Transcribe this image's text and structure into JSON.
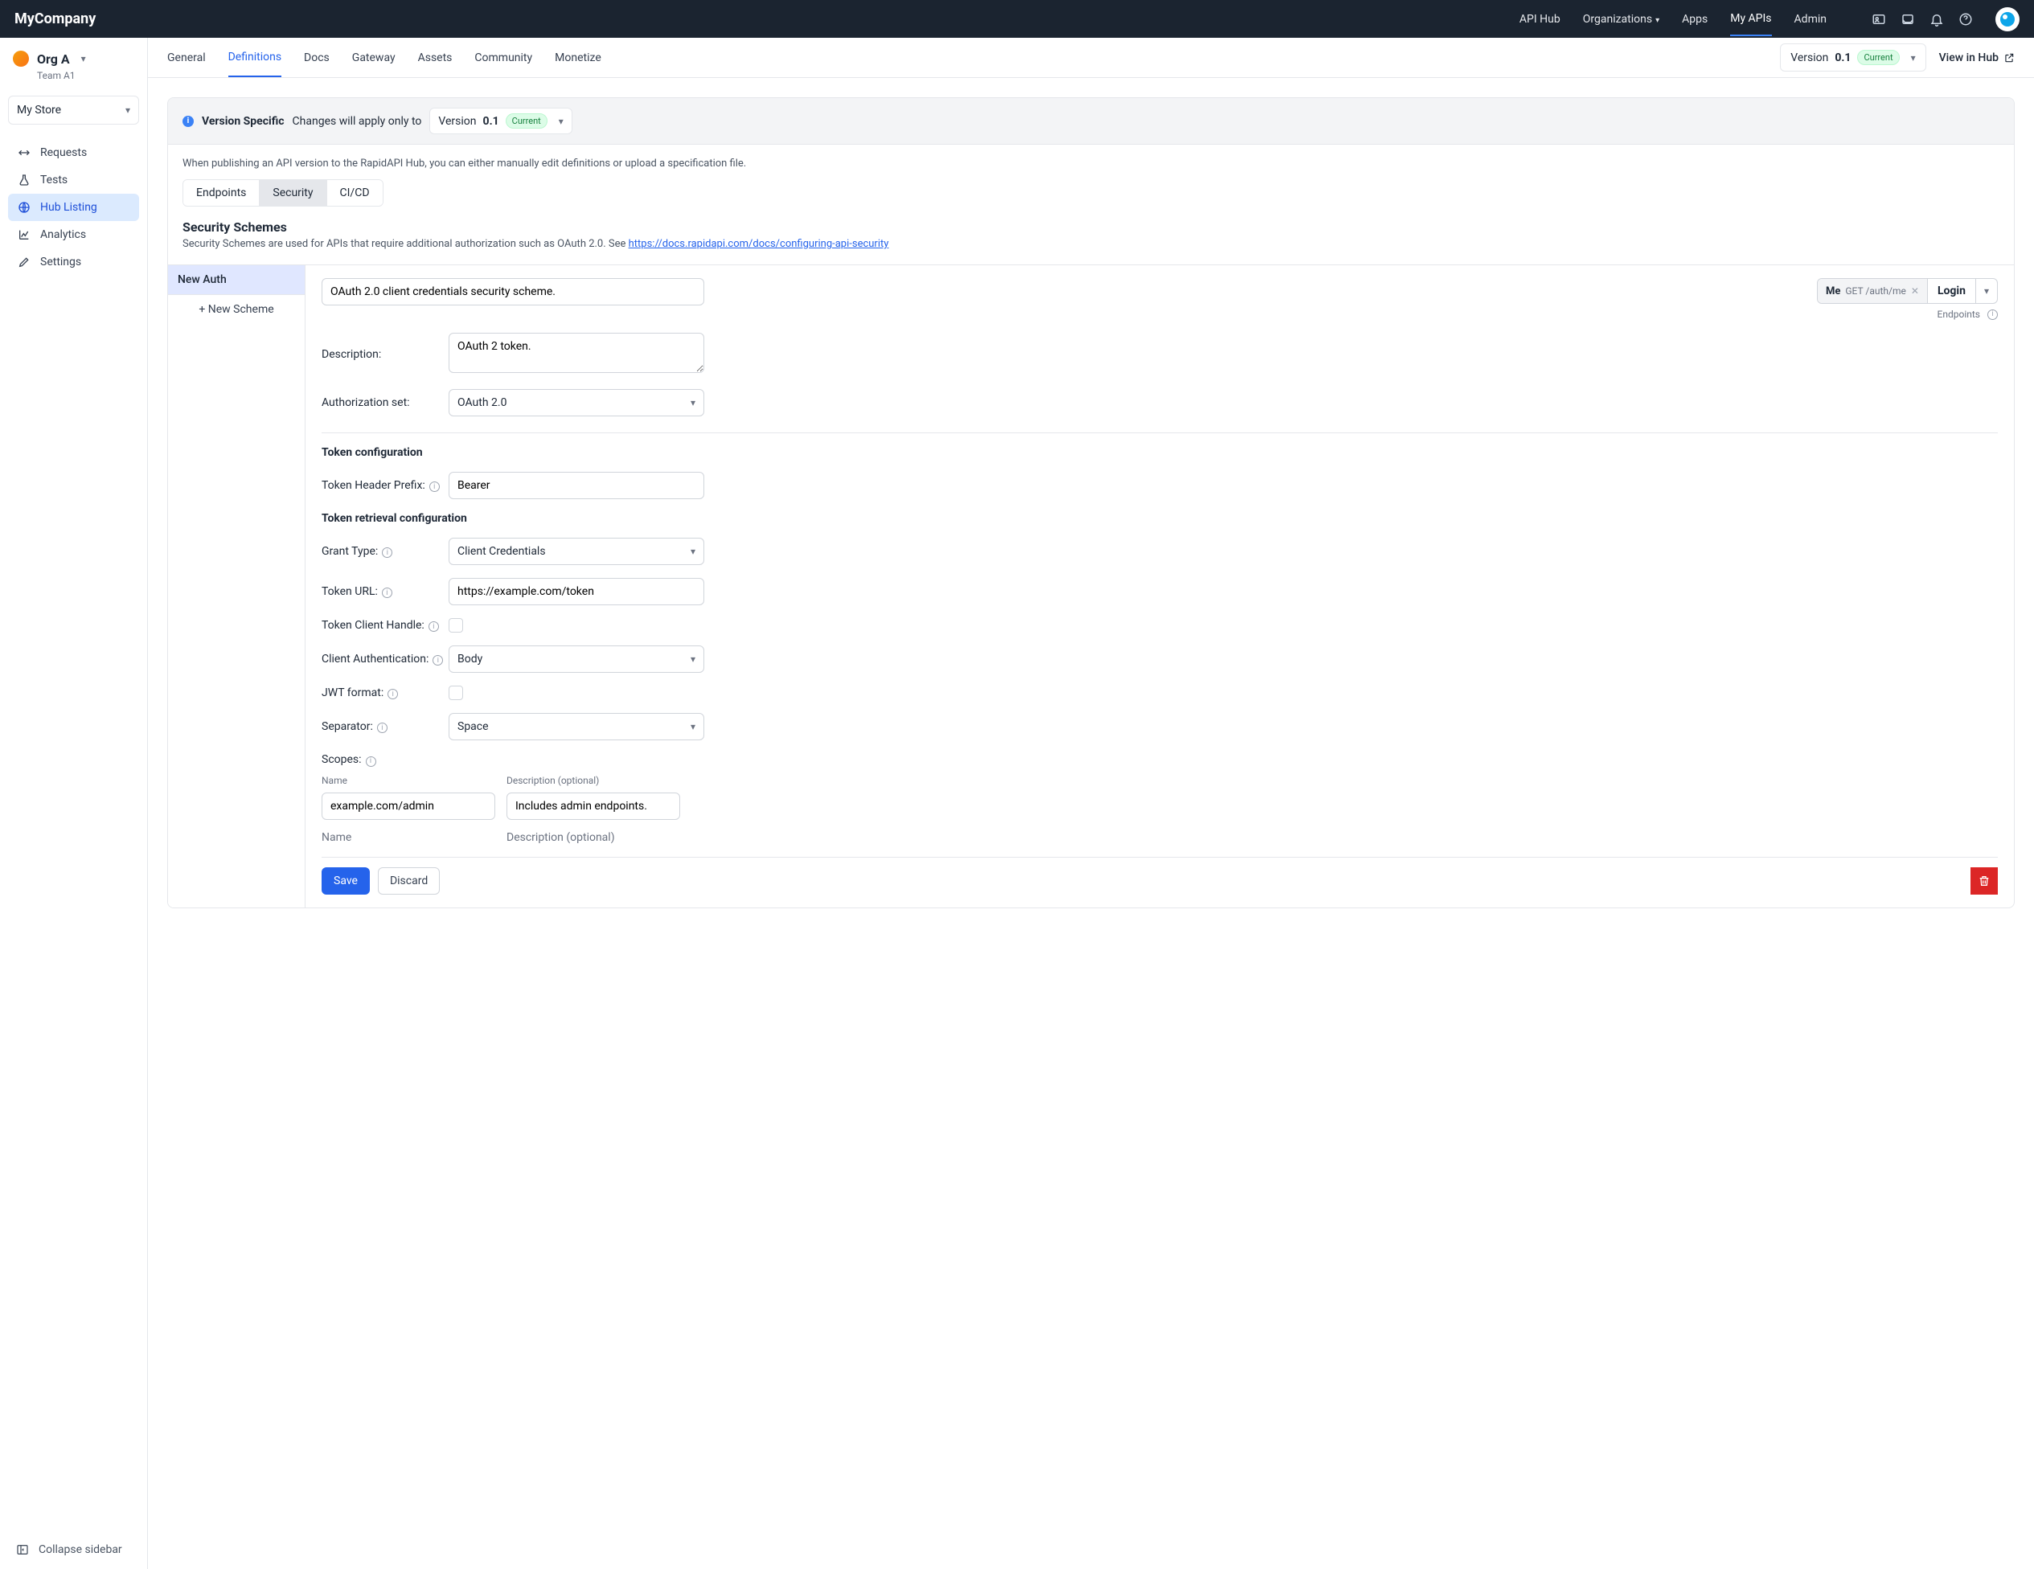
{
  "brand": "MyCompany",
  "topnav": {
    "api_hub": "API Hub",
    "organizations": "Organizations",
    "apps": "Apps",
    "my_apis": "My APIs",
    "admin": "Admin"
  },
  "org": {
    "name": "Org A",
    "team": "Team A1"
  },
  "store_picker": "My Store",
  "sidenav": {
    "requests": "Requests",
    "tests": "Tests",
    "hub_listing": "Hub Listing",
    "analytics": "Analytics",
    "settings": "Settings"
  },
  "collapse": "Collapse sidebar",
  "subtabs": {
    "general": "General",
    "definitions": "Definitions",
    "docs": "Docs",
    "gateway": "Gateway",
    "assets": "Assets",
    "community": "Community",
    "monetize": "Monetize"
  },
  "version": {
    "label": "Version",
    "num": "0.1",
    "current": "Current"
  },
  "view_in_hub": "View in Hub",
  "banner": {
    "vs": "Version Specific",
    "msg": "Changes will apply only to",
    "version_label": "Version",
    "version_num": "0.1",
    "current": "Current"
  },
  "pubnote": "When publishing an API version to the RapidAPI Hub, you can either manually edit definitions or upload a specification file.",
  "seg": {
    "endpoints": "Endpoints",
    "security": "Security",
    "cicd": "CI/CD"
  },
  "sec": {
    "title": "Security Schemes",
    "desc": "Security Schemes are used for APIs that require additional authorization such as OAuth 2.0. See ",
    "link": "https://docs.rapidapi.com/docs/configuring-api-security"
  },
  "schemes": {
    "active": "New Auth",
    "new": "+ New Scheme"
  },
  "right": {
    "chip_name": "Me",
    "chip_method": "GET",
    "chip_path": "/auth/me",
    "login": "Login",
    "endpoints": "Endpoints"
  },
  "form": {
    "title": "OAuth 2.0 client credentials security scheme.",
    "desc_label": "Description:",
    "desc_value": "OAuth 2 token.",
    "authset_label": "Authorization set:",
    "authset_value": "OAuth 2.0",
    "tokencfg": "Token configuration",
    "thp_label": "Token Header Prefix:",
    "thp_value": "Bearer",
    "trc": "Token retrieval configuration",
    "grant_label": "Grant Type:",
    "grant_value": "Client Credentials",
    "tokenurl_label": "Token URL:",
    "tokenurl_value": "https://example.com/token",
    "tch_label": "Token Client Handle:",
    "clientauth_label": "Client Authentication:",
    "clientauth_value": "Body",
    "jwt_label": "JWT format:",
    "sep_label": "Separator:",
    "sep_value": "Space",
    "scopes_label": "Scopes:",
    "scope_name_h": "Name",
    "scope_desc_h": "Description (optional)",
    "scope0_name": "example.com/admin",
    "scope0_desc": "Includes admin endpoints.",
    "scope_ph_name": "Name",
    "scope_ph_desc": "Description (optional)"
  },
  "buttons": {
    "save": "Save",
    "discard": "Discard"
  }
}
